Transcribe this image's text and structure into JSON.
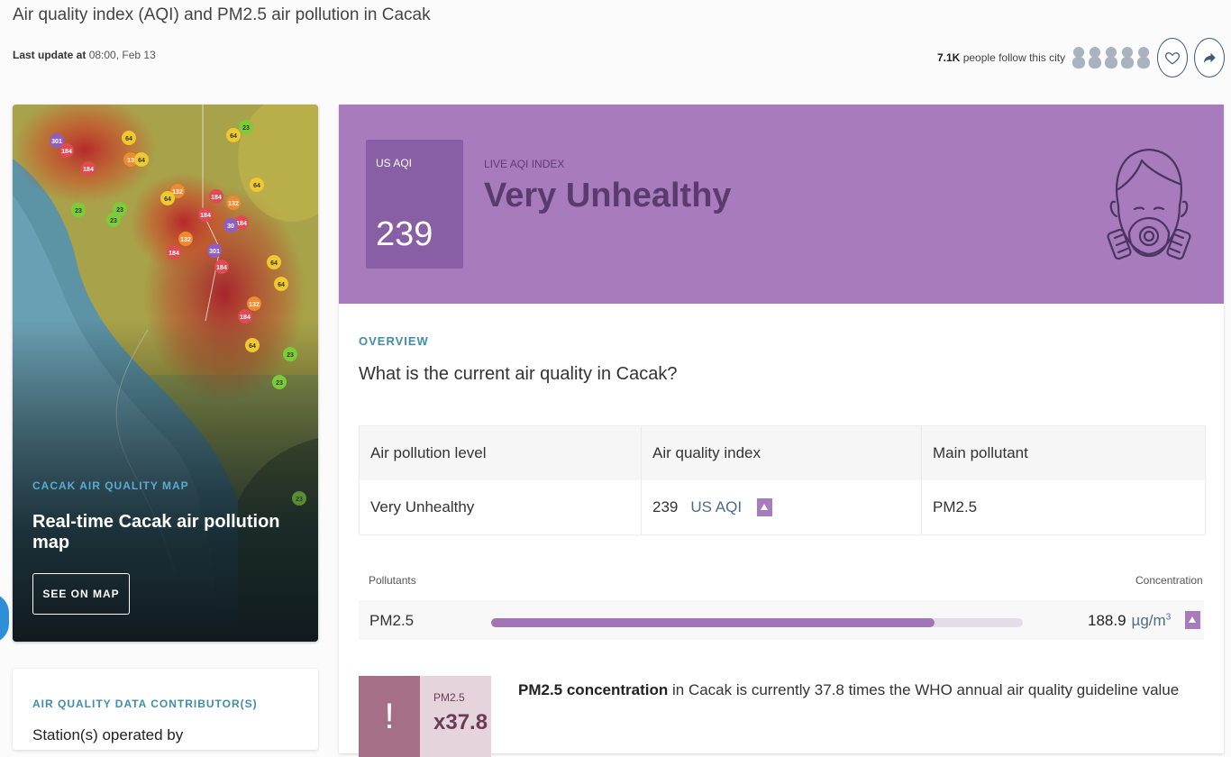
{
  "header": {
    "title": "Air quality index (AQI) and PM2.5 air pollution in Cacak",
    "last_update_label": "Last update at",
    "last_update_value": "08:00, Feb 13",
    "followers_count": "7.1K",
    "followers_text": "people follow this city"
  },
  "map_card": {
    "label": "CACAK AIR QUALITY MAP",
    "title": "Real-time Cacak air pollution map",
    "button_label": "SEE ON MAP",
    "markers": [
      "301",
      "184",
      "184",
      "64",
      "13",
      "64",
      "64",
      "23",
      "132",
      "64",
      "184",
      "132",
      "184",
      "64",
      "23",
      "23",
      "23",
      "184",
      "30",
      "184",
      "132",
      "301",
      "184",
      "64",
      "64",
      "132",
      "184",
      "64",
      "23",
      "23",
      "23"
    ]
  },
  "contributor_card": {
    "label": "AIR QUALITY DATA CONTRIBUTOR(S)",
    "text": "Station(s) operated by"
  },
  "banner": {
    "aqi_label": "US AQI",
    "aqi_value": "239",
    "live_label": "LIVE AQI INDEX",
    "status": "Very Unhealthy",
    "icon": "gas-mask-person-icon",
    "color": "#a87bbd"
  },
  "overview": {
    "label": "OVERVIEW",
    "question": "What is the current air quality in Cacak?",
    "table": {
      "headers": [
        "Air pollution level",
        "Air quality index",
        "Main pollutant"
      ],
      "level": "Very Unhealthy",
      "aqi": "239",
      "aqi_unit": "US AQI",
      "main_pollutant": "PM2.5"
    }
  },
  "pollutants": {
    "header_left": "Pollutants",
    "header_right": "Concentration",
    "rows": [
      {
        "name": "PM2.5",
        "value": "188.9",
        "unit": "µg/m",
        "unit_sup": "3",
        "level_fraction": 0.834
      }
    ]
  },
  "who": {
    "icon": "!",
    "pollutant": "PM2.5",
    "multiplier": "x37.8",
    "text_bold": "PM2.5 concentration",
    "text_rest": " in Cacak is currently 37.8 times the WHO annual air quality guideline value"
  }
}
